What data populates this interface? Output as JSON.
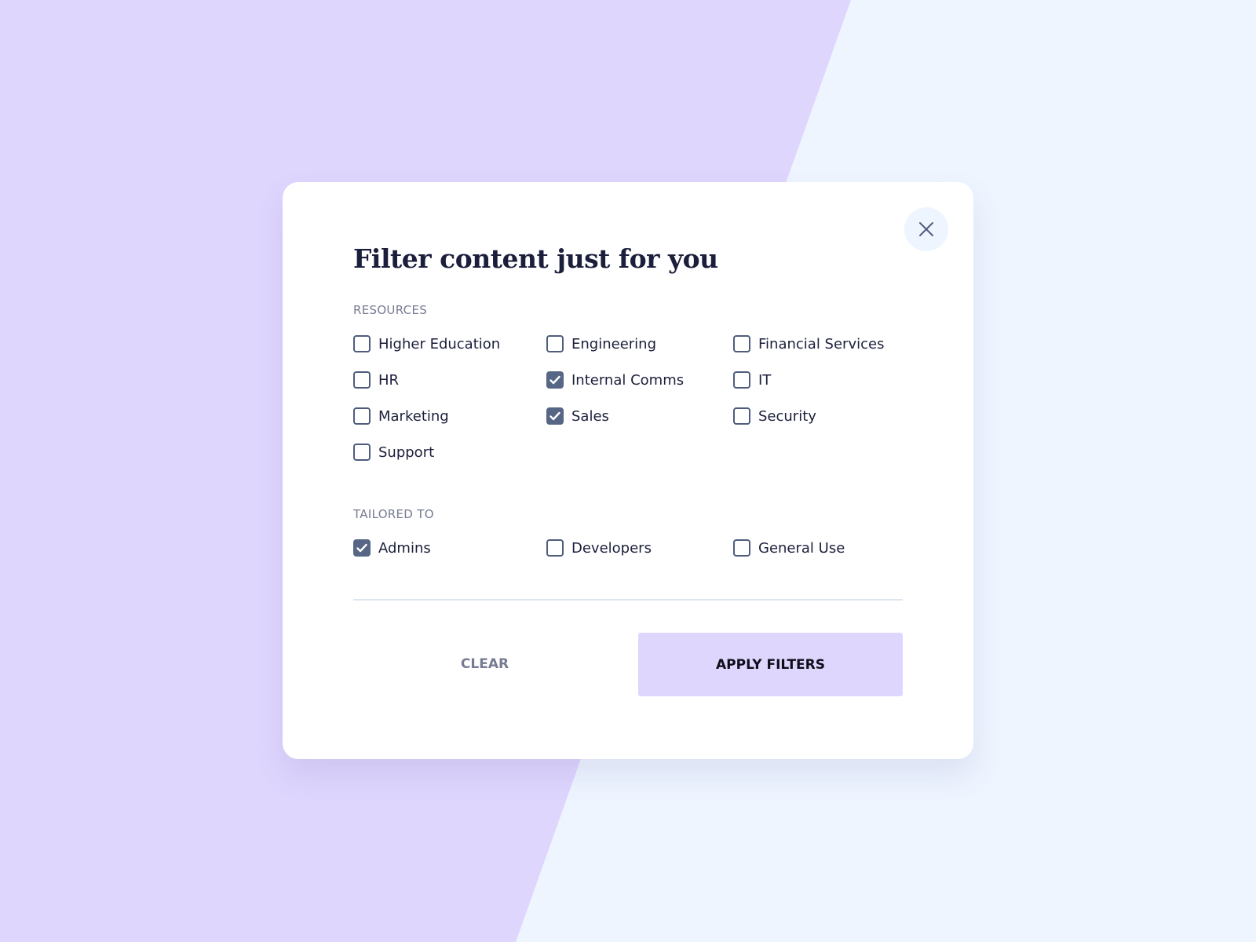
{
  "modal": {
    "title": "Filter content just for you",
    "close_icon": "close-icon"
  },
  "resources": {
    "label": "RESOURCES",
    "options": [
      {
        "label": "Higher Education",
        "checked": false
      },
      {
        "label": "Engineering",
        "checked": false
      },
      {
        "label": "Financial Services",
        "checked": false
      },
      {
        "label": "HR",
        "checked": false
      },
      {
        "label": "Internal Comms",
        "checked": true
      },
      {
        "label": "IT",
        "checked": false
      },
      {
        "label": "Marketing",
        "checked": false
      },
      {
        "label": "Sales",
        "checked": true
      },
      {
        "label": "Security",
        "checked": false
      },
      {
        "label": "Support",
        "checked": false
      }
    ]
  },
  "tailored": {
    "label": "TAILORED TO",
    "options": [
      {
        "label": "Admins",
        "checked": true
      },
      {
        "label": "Developers",
        "checked": false
      },
      {
        "label": "General Use",
        "checked": false
      }
    ]
  },
  "actions": {
    "clear_label": "CLEAR",
    "apply_label": "APPLY FILTERS"
  },
  "colors": {
    "background_purple": "#dfd6fe",
    "background_blue": "#eef5ff",
    "checkbox_checked": "#566684",
    "title_text": "#1b1f3b",
    "label_gray": "#767b91"
  }
}
